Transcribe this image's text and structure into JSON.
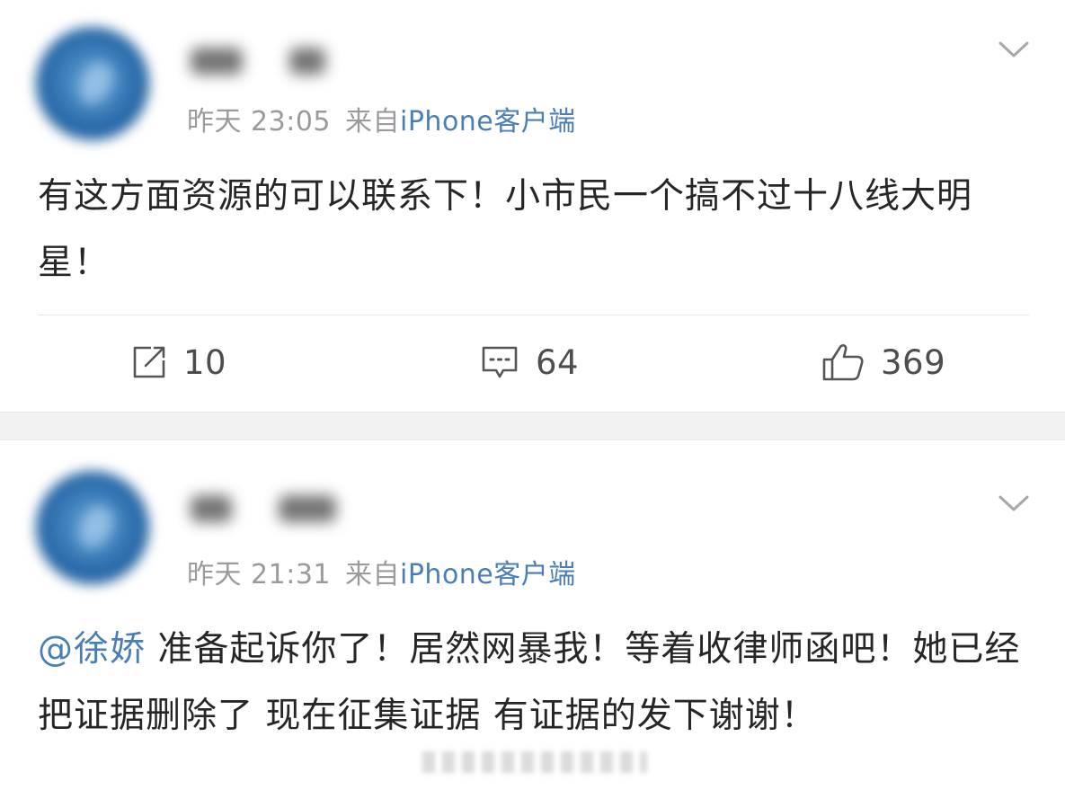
{
  "posts": [
    {
      "time": "昨天 23:05",
      "from_prefix": "来自",
      "source": "iPhone客户端",
      "text": "有这方面资源的可以联系下！小市民一个搞不过十八线大明星！",
      "actions": {
        "repost_count": "10",
        "comment_count": "64",
        "like_count": "369"
      }
    },
    {
      "time": "昨天 21:31",
      "from_prefix": "来自",
      "source": "iPhone客户端",
      "mention": "@徐娇",
      "text": " 准备起诉你了！居然网暴我！等着收律师函吧！她已经把证据删除了 现在征集证据 有证据的发下谢谢！"
    }
  ],
  "icons": {
    "avatar": "avatar-image",
    "more": "chevron-down-icon",
    "repost": "repost-icon",
    "comment": "comment-icon",
    "like": "thumbs-up-icon"
  },
  "colors": {
    "link": "#4a7fb6",
    "meta": "#9b9b9b",
    "text": "#262626",
    "separator": "#f2f2f2"
  }
}
